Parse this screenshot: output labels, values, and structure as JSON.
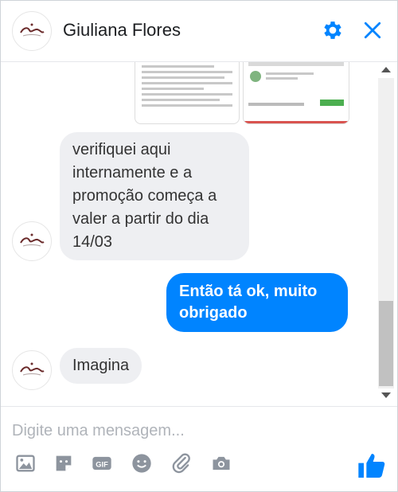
{
  "header": {
    "contact_name": "Giuliana Flores",
    "avatar_logo": "Giuliana Flores logo",
    "icons": [
      "gear-icon",
      "close-icon"
    ]
  },
  "messages": [
    {
      "from": "contact",
      "text": "verifiquei aqui internamente e a promoção começa a valer a partir do dia 14/03"
    },
    {
      "from": "me",
      "text": "Então tá ok, muito obrigado"
    },
    {
      "from": "contact",
      "text": "Imagina"
    }
  ],
  "composer": {
    "placeholder": "Digite uma mensagem...",
    "tools": [
      "photo-icon",
      "sticker-icon",
      "gif-icon",
      "emoji-icon",
      "attachment-icon",
      "camera-icon",
      "like-icon"
    ]
  },
  "colors": {
    "accent": "#0084ff",
    "incoming_bubble": "#eeeff2",
    "tool_gray": "#8d949e"
  }
}
